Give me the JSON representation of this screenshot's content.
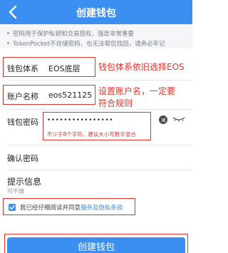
{
  "header": {
    "title": "创建钱包"
  },
  "notes": [
    "密码用于保护私钥和交易授权，强度非常重要",
    "TokenPocket不存储密码，也无法帮您找回，请务必牢记"
  ],
  "form": {
    "wallet_system_label": "钱包体系",
    "wallet_system_value": "EOS底层",
    "account_label": "账户名称",
    "account_value": "eos521125",
    "password_label": "钱包密码",
    "password_value": "••••••••••••••••",
    "password_hint": "不少于8个字符，建议大小写数字混合",
    "confirm_label": "确认密码",
    "prompt_label": "提示信息",
    "prompt_hint": "可不填"
  },
  "annotations": {
    "system": "钱包体系依旧选择EOS",
    "account_line1": "设置账户名，一定要",
    "account_line2": "符合规则"
  },
  "agreement": {
    "text": "我已经仔细阅读并同意",
    "link": "服务及隐私条款",
    "checked": true
  },
  "create_button": "创建钱包",
  "colors": {
    "primary": "#3b8ff0",
    "annotation": "#e8332a"
  },
  "icons": [
    "back-arrow-icon",
    "clear-icon",
    "eye-closed-icon",
    "checkmark-icon"
  ]
}
